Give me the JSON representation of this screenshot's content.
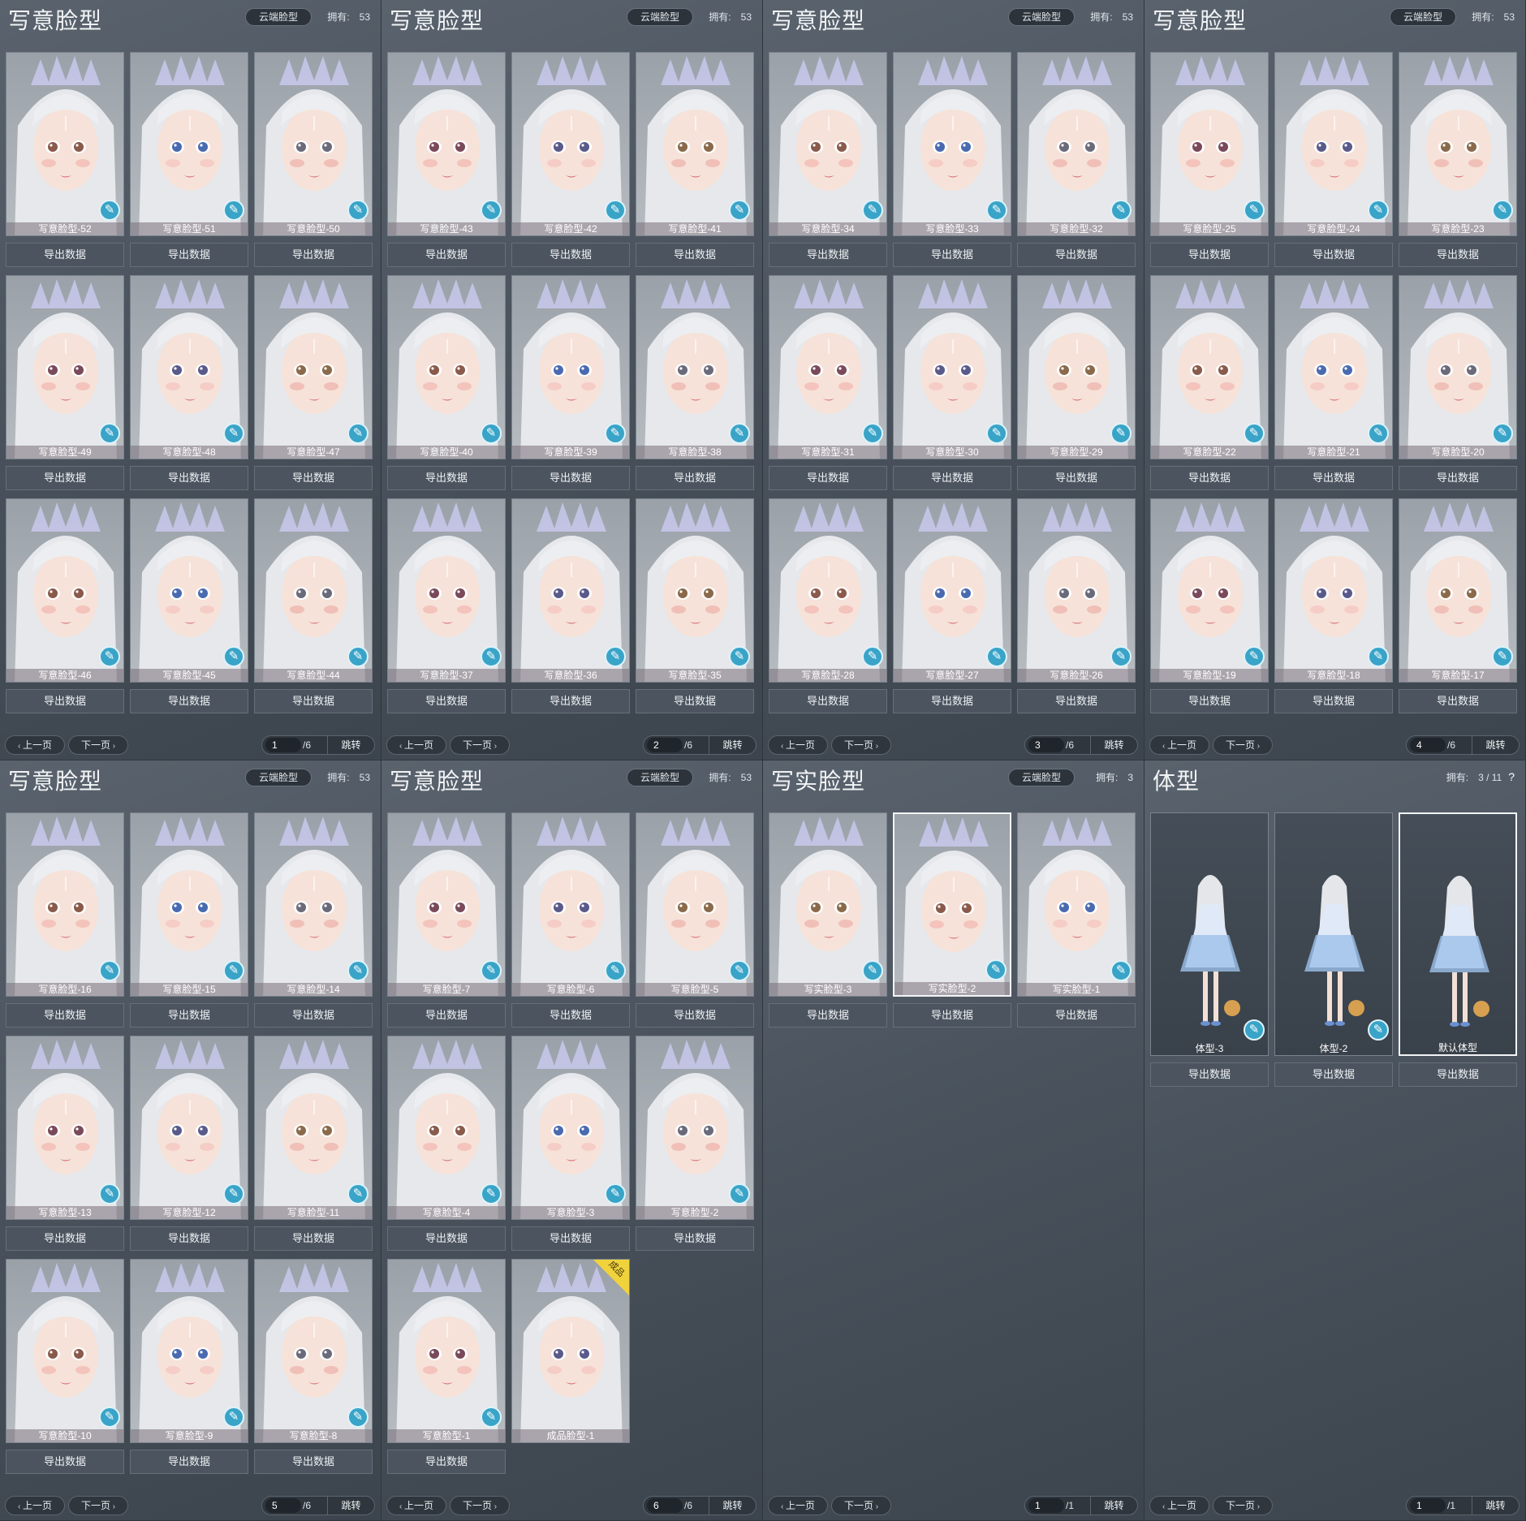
{
  "colors": {
    "panel_bg": "#4a535d",
    "edit_badge": "#39a4c8",
    "finished_tag": "#f0d23c",
    "export_button": "#4c555f"
  },
  "common": {
    "cloud_button": "云端脸型",
    "owned_label": "拥有:",
    "export_label": "导出数据",
    "prev_label": "上一页",
    "next_label": "下一页",
    "jump_label": "跳转",
    "edit_icon": "brush-icon",
    "help_label": "?"
  },
  "panels": [
    {
      "title": "写意脸型",
      "owned": "53",
      "page": "1",
      "total": "/6",
      "items": [
        "写意脸型-52",
        "写意脸型-51",
        "写意脸型-50",
        "写意脸型-49",
        "写意脸型-48",
        "写意脸型-47",
        "写意脸型-46",
        "写意脸型-45",
        "写意脸型-44"
      ]
    },
    {
      "title": "写意脸型",
      "owned": "53",
      "page": "2",
      "total": "/6",
      "items": [
        "写意脸型-43",
        "写意脸型-42",
        "写意脸型-41",
        "写意脸型-40",
        "写意脸型-39",
        "写意脸型-38",
        "写意脸型-37",
        "写意脸型-36",
        "写意脸型-35"
      ]
    },
    {
      "title": "写意脸型",
      "owned": "53",
      "page": "3",
      "total": "/6",
      "items": [
        "写意脸型-34",
        "写意脸型-33",
        "写意脸型-32",
        "写意脸型-31",
        "写意脸型-30",
        "写意脸型-29",
        "写意脸型-28",
        "写意脸型-27",
        "写意脸型-26"
      ]
    },
    {
      "title": "写意脸型",
      "owned": "53",
      "page": "4",
      "total": "/6",
      "items": [
        "写意脸型-25",
        "写意脸型-24",
        "写意脸型-23",
        "写意脸型-22",
        "写意脸型-21",
        "写意脸型-20",
        "写意脸型-19",
        "写意脸型-18",
        "写意脸型-17"
      ]
    },
    {
      "title": "写意脸型",
      "owned": "53",
      "page": "5",
      "total": "/6",
      "items": [
        "写意脸型-16",
        "写意脸型-15",
        "写意脸型-14",
        "写意脸型-13",
        "写意脸型-12",
        "写意脸型-11",
        "写意脸型-10",
        "写意脸型-9",
        "写意脸型-8"
      ]
    },
    {
      "title": "写意脸型",
      "owned": "53",
      "page": "6",
      "total": "/6",
      "items": [
        "写意脸型-7",
        "写意脸型-6",
        "写意脸型-5",
        "写意脸型-4",
        "写意脸型-3",
        "写意脸型-2",
        "写意脸型-1",
        "成品脸型-1"
      ],
      "finished_tag": "成品"
    },
    {
      "title": "写实脸型",
      "owned": "3",
      "page": "1",
      "total": "/1",
      "items": [
        "写实脸型-3",
        "写实脸型-2",
        "写实脸型-1"
      ],
      "selected": "写实脸型-2"
    },
    {
      "title": "体型",
      "owned": "3 / 11",
      "page": "1",
      "total": "/1",
      "items": [
        "体型-3",
        "体型-2",
        "默认体型"
      ],
      "selected": "默认体型",
      "body_type": true
    }
  ]
}
